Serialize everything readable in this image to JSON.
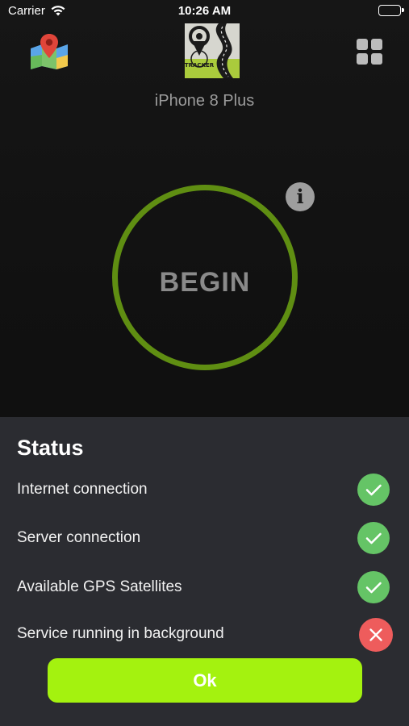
{
  "status_bar": {
    "carrier": "Carrier",
    "time": "10:26 AM",
    "battery_icon": "battery-full-icon",
    "wifi_icon": "wifi-icon"
  },
  "header": {
    "map_icon": "map-pin-icon",
    "logo_icon": "tracker-logo-icon",
    "logo_text": "TRACKER",
    "menu_icon": "grid-icon",
    "device_name": "iPhone 8 Plus"
  },
  "main": {
    "begin_label": "BEGIN",
    "info_icon": "info-icon",
    "info_glyph": "i",
    "ring_color": "#5f8e12"
  },
  "status_sheet": {
    "title": "Status",
    "items": [
      {
        "label": "Internet connection",
        "ok": true,
        "icon": "check-icon"
      },
      {
        "label": "Server connection",
        "ok": true,
        "icon": "check-icon"
      },
      {
        "label": "Available GPS Satellites",
        "ok": true,
        "icon": "check-icon"
      },
      {
        "label": "Service running in background",
        "ok": false,
        "icon": "close-icon"
      }
    ],
    "ok_button": "Ok"
  },
  "colors": {
    "ok_green": "#65c466",
    "error_red": "#ee5c5c",
    "accent_lime": "#a4f20f",
    "sheet_bg": "#2b2c31"
  }
}
